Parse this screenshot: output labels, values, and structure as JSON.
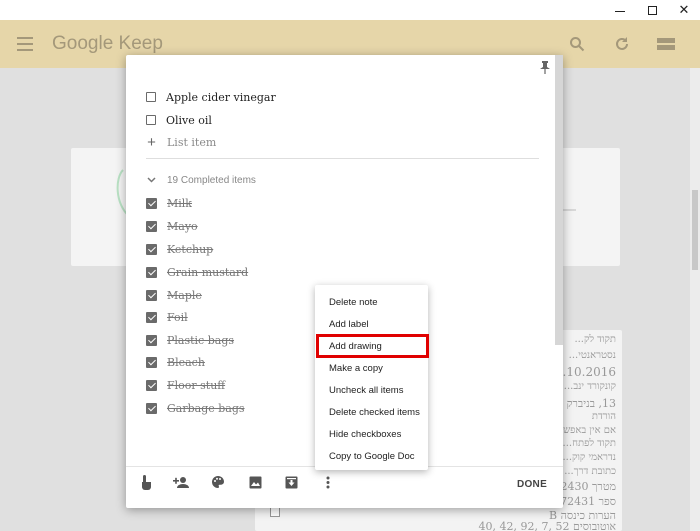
{
  "window": {
    "minimize_label": "–",
    "maximize_label": "□",
    "close_label": "✕"
  },
  "header": {
    "title": "Google Keep",
    "bg_color": "#e6d6a9",
    "icons": [
      "menu-icon",
      "search-icon",
      "refresh-icon",
      "list-view-icon"
    ]
  },
  "note": {
    "pin_icon": "pin-icon",
    "items": [
      {
        "label": "Apple cider vinegar",
        "checked": false
      },
      {
        "label": "Olive oil",
        "checked": false
      }
    ],
    "add_item_placeholder": "List item",
    "completed_label": "19 Completed items",
    "completed_items": [
      {
        "label": "Milk",
        "checked": true
      },
      {
        "label": "Mayo",
        "checked": true
      },
      {
        "label": "Ketchup",
        "checked": true
      },
      {
        "label": "Grain mustard",
        "checked": true
      },
      {
        "label": "Maple",
        "checked": true
      },
      {
        "label": "Foil",
        "checked": true
      },
      {
        "label": "Plastic bags",
        "checked": true
      },
      {
        "label": "Bleach",
        "checked": true
      },
      {
        "label": "Floor stuff",
        "checked": true
      },
      {
        "label": "Garbage bags",
        "checked": true
      }
    ],
    "toolbar_icons": [
      "remind-me-icon",
      "collaborator-icon",
      "palette-icon",
      "image-icon",
      "archive-icon",
      "more-icon"
    ],
    "done_label": "DONE"
  },
  "context_menu": {
    "items": [
      "Delete note",
      "Add label",
      "Add drawing",
      "Make a copy",
      "Uncheck all items",
      "Delete checked items",
      "Hide checkboxes",
      "Copy to Google Doc"
    ],
    "highlighted": "Add drawing",
    "highlight_color": "#e00000"
  },
  "background_note": {
    "lines": [
      "תקוד לק...",
      "נסטראנטי...",
      "28.10.2016",
      "קונקורד ינב...",
      "13, בניברק",
      "הורדת",
      "אם אין באפש...",
      "תקוד לפתח...",
      "נדראמי קוק...",
      "כתובת דרך...",
      "מטרך 2430",
      "ספר 72431",
      "הערות כינסה B",
      "אוטובוסים 52 ,7 ,92 ,42 ,40"
    ]
  }
}
